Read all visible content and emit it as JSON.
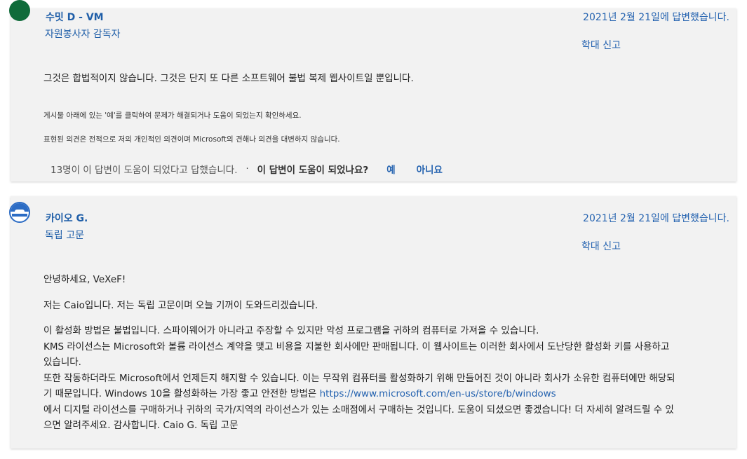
{
  "replies": [
    {
      "author": "수밋 D - VM",
      "role": "자원봉사자 감독자",
      "date": "2021년 2월 21일에 답변했습니다.",
      "report": "학대 신고",
      "body": "그것은 합법적이지 않습니다. 그것은 단지 또 다른 소프트웨어 불법 복제 웹사이트일 뿐입니다.",
      "notes": [
        "게시물 아래에 있는 '예'를 클릭하여 문제가 해결되거나 도움이 되었는지 확인하세요.",
        "표현된 의견은 전적으로 저의 개인적인 의견이며 Microsoft의 견해나 의견을 대변하지 않습니다."
      ],
      "helpful_count": "13명이 이 답변이 도움이 되었다고 답했습니다.",
      "separator": "·",
      "question": "이 답변이 도움이 되었나요?",
      "yes": "예",
      "no": "아니요"
    },
    {
      "author": "카이오 G.",
      "role": "독립 고문",
      "date": "2021년 2월 21일에 답변했습니다.",
      "report": "학대 신고",
      "greeting": "안녕하세요, VeXeF!",
      "intro": "저는 Caio입니다. 저는 독립 고문이며 오늘 기꺼이 도와드리겠습니다.",
      "lines": [
        "이 활성화 방법은 불법입니다. 스파이웨어가 아니라고 주장할 수 있지만 악성 프로그램을 귀하의 컴퓨터로 가져올 수 있습니다.",
        "KMS 라이선스는 Microsoft와 볼륨 라이선스 계약을 맺고 비용을 지불한 회사에만 판매됩니다. 이 웹사이트는 이러한 회사에서 도난당한 활성화 키를 사용하고",
        "있습니다.",
        "또한 작동하더라도 Microsoft에서 언제든지 해지할 수 있습니다. 이는 무작위 컴퓨터를 활성화하기 위해 만들어진 것이 아니라 회사가 소유한 컴퓨터에만 해당되",
        "기 때문입니다. Windows 10을 활성화하는 가장 좋고 안전한 방법은"
      ],
      "link": "https://www.microsoft.com/en-us/store/b/windows",
      "tail_lines": [
        "에서 디지털 라이선스를 구매하거나 귀하의 국가/지역의 라이선스가 있는 소매점에서 구매하는 것입니다. 도움이 되셨으면 좋겠습니다! 더 자세히 알려드릴 수 있",
        "으면 알려주세요. 감사합니다. Caio G. 독립 고문"
      ]
    }
  ]
}
